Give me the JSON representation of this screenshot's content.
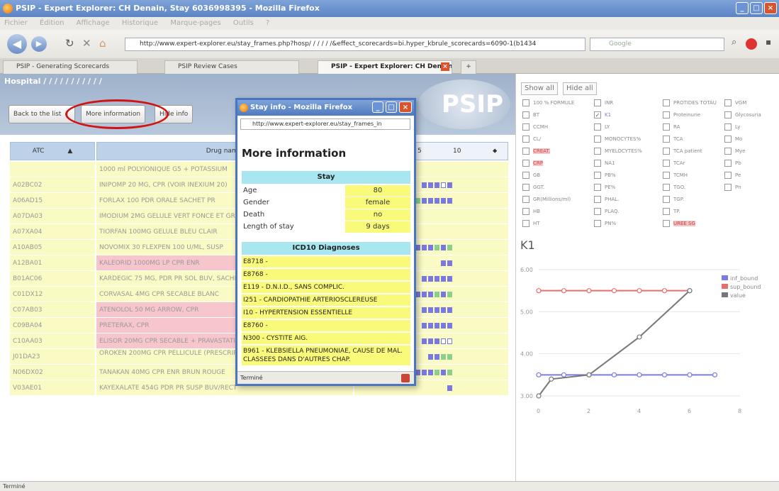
{
  "window": {
    "title": "PSIP - Expert Explorer: CH Denain, Stay 6036998395 - Mozilla Firefox"
  },
  "menu": [
    "Fichier",
    "Édition",
    "Affichage",
    "Historique",
    "Marque-pages",
    "Outils",
    "?"
  ],
  "nav": {
    "url": "http://www.expert-explorer.eu/stay_frames.php?hosp/ / / / / /&effect_scorecards=bi.hyper_kbrule_scorecards=6090-1(b1434",
    "search_placeholder": "Google"
  },
  "tabs": [
    {
      "label": "PSIP - Generating Scorecards"
    },
    {
      "label": "PSIP Review Cases"
    },
    {
      "label": "PSIP - Expert Explorer: CH Denain..."
    }
  ],
  "left": {
    "hospital_label": "Hospital",
    "hospital_name": "/ / / / / / / / / / /",
    "buttons": {
      "back": "Back to the list",
      "more": "More information",
      "hide": "Hide info"
    },
    "logo": "PSIP",
    "table": {
      "col_atc": "ATC",
      "col_drug": "Drug name",
      "col_5": "5",
      "col_10": "10",
      "rows": [
        {
          "atc": "",
          "drug": "1000 ml POLYIONIQUE G5 + POTASSIUM",
          "pink": false,
          "bar": ""
        },
        {
          "atc": "A02BC02",
          "drug": "INIPOMP 20 MG, CPR (VOIR INEXIUM 20)",
          "pink": false,
          "bar": "bbbeb"
        },
        {
          "atc": "A06AD15",
          "drug": "FORLAX 100 PDR ORALE SACHET PR",
          "pink": false,
          "bar": "gbbbbb"
        },
        {
          "atc": "A07DA03",
          "drug": "IMODIUM 2MG GELULE VERT FONCE ET GRIS",
          "pink": false,
          "bar": ""
        },
        {
          "atc": "A07XA04",
          "drug": "TIORFAN 100MG GELULE BLEU CLAIR",
          "pink": false,
          "bar": ""
        },
        {
          "atc": "A10AB05",
          "drug": "NOVOMIX 30 FLEXPEN 100 U/ML, SUSP",
          "pink": false,
          "bar": "bbbgbg"
        },
        {
          "atc": "A12BA01",
          "drug": "KALEORID 1000MG LP CPR ENR",
          "pink": true,
          "bar": "bb"
        },
        {
          "atc": "B01AC06",
          "drug": "KARDEGIC 75 MG, PDR PR SOL BUV, SACHET",
          "pink": false,
          "bar": "bbbbb"
        },
        {
          "atc": "C01DX12",
          "drug": "CORVASAL 4MG CPR SECABLE BLANC",
          "pink": false,
          "bar": "bbbgbg"
        },
        {
          "atc": "C07AB03",
          "drug": "ATENOLOL 50 MG ARROW, CPR",
          "pink": true,
          "bar": "bbbbb"
        },
        {
          "atc": "C09BA04",
          "drug": "PRETERAX, CPR",
          "pink": true,
          "bar": "bbbbb"
        },
        {
          "atc": "C10AA03",
          "drug": "ELISOR 20MG CPR SECABLE + PRAVASTATINE",
          "pink": true,
          "bar": "bbbee"
        },
        {
          "atc": "J01DA23",
          "drug": "OROKEN 200MG CPR PELLICULE (PRESCRIPTION OBLIGATOIRE ANTIBIO)",
          "pink": false,
          "bar": "bbgg"
        },
        {
          "atc": "N06DX02",
          "drug": "TANAKAN 40MG CPR ENR BRUN ROUGE",
          "pink": false,
          "bar": "gbbbbbgbg"
        },
        {
          "atc": "V03AE01",
          "drug": "KAYEXALATE 454G PDR PR SUSP BUV/RECT",
          "pink": false,
          "bar": "b"
        }
      ]
    }
  },
  "popup": {
    "title": "Stay info - Mozilla Firefox",
    "url": "http://www.expert-explorer.eu/stay_frames_in",
    "heading": "More information",
    "stay_header": "Stay",
    "stay": [
      {
        "label": "Age",
        "value": "80"
      },
      {
        "label": "Gender",
        "value": "female"
      },
      {
        "label": "Death",
        "value": "no"
      },
      {
        "label": "Length of stay",
        "value": "9 days"
      }
    ],
    "diag_header": "ICD10 Diagnoses",
    "diagnoses": [
      "E8718 -",
      "E8768 -",
      "E119 -  D.N.I.D., SANS COMPLIC.",
      "I251 -  CARDIOPATHIE ARTERIOSCLEREUSE",
      "I10 -  HYPERTENSION ESSENTIELLE",
      "E8760 -",
      "N300 -  CYSTITE AIG.",
      "B961 -  KLEBSIELLA PNEUMONIAE, CAUSE DE MAL. CLASSEES DANS D'AUTRES CHAP."
    ],
    "status": "Terminé"
  },
  "right": {
    "show_all": "Show all",
    "hide_all": "Hide all",
    "checkboxes": [
      [
        {
          "label": "100 % FORMULE",
          "checked": false,
          "red": false
        },
        {
          "label": "BT",
          "checked": false,
          "red": false
        },
        {
          "label": "CCMH",
          "checked": false,
          "red": false
        },
        {
          "label": "CL/",
          "checked": false,
          "red": false
        },
        {
          "label": "CREAT.",
          "checked": false,
          "red": true
        },
        {
          "label": "CRP",
          "checked": false,
          "red": true
        },
        {
          "label": "GB",
          "checked": false,
          "red": false
        },
        {
          "label": "GGT.",
          "checked": false,
          "red": false
        },
        {
          "label": "GR(Millions/ml)",
          "checked": false,
          "red": false
        },
        {
          "label": "HB",
          "checked": false,
          "red": false
        },
        {
          "label": "HT",
          "checked": false,
          "red": false
        }
      ],
      [
        {
          "label": "INR",
          "checked": false,
          "red": false
        },
        {
          "label": "K1",
          "checked": true,
          "red": false
        },
        {
          "label": "LY",
          "checked": false,
          "red": false
        },
        {
          "label": "MONOCYTES%",
          "checked": false,
          "red": false
        },
        {
          "label": "MYELOCYTES%",
          "checked": false,
          "red": false
        },
        {
          "label": "NA1",
          "checked": false,
          "red": false
        },
        {
          "label": "PB%",
          "checked": false,
          "red": false
        },
        {
          "label": "PE%",
          "checked": false,
          "red": false
        },
        {
          "label": "PHAL.",
          "checked": false,
          "red": false
        },
        {
          "label": "PLAQ.",
          "checked": false,
          "red": false
        },
        {
          "label": "PN%",
          "checked": false,
          "red": false
        }
      ],
      [
        {
          "label": "PROTIDES TOTAU",
          "checked": false,
          "red": false
        },
        {
          "label": "Proteinurie",
          "checked": false,
          "red": false
        },
        {
          "label": "RA",
          "checked": false,
          "red": false
        },
        {
          "label": "TCA",
          "checked": false,
          "red": false
        },
        {
          "label": "TCA patient",
          "checked": false,
          "red": false
        },
        {
          "label": "TCAr",
          "checked": false,
          "red": false
        },
        {
          "label": "TCMH",
          "checked": false,
          "red": false
        },
        {
          "label": "TGO.",
          "checked": false,
          "red": false
        },
        {
          "label": "TGP.",
          "checked": false,
          "red": false
        },
        {
          "label": "TP.",
          "checked": false,
          "red": false
        },
        {
          "label": "UREE SG",
          "checked": false,
          "red": true
        }
      ],
      [
        {
          "label": "VGM",
          "checked": false,
          "red": false
        },
        {
          "label": "Glycosuria",
          "checked": false,
          "red": false
        },
        {
          "label": "Ly",
          "checked": false,
          "red": false
        },
        {
          "label": "Mo",
          "checked": false,
          "red": false
        },
        {
          "label": "Mye",
          "checked": false,
          "red": false
        },
        {
          "label": "Pb",
          "checked": false,
          "red": false
        },
        {
          "label": "Pe",
          "checked": false,
          "red": false
        },
        {
          "label": "Pn",
          "checked": false,
          "red": false
        }
      ]
    ],
    "chart_title": "K1"
  },
  "chart_data": {
    "type": "line",
    "title": "K1",
    "xlim": [
      0,
      8
    ],
    "ylim": [
      3.0,
      6.0
    ],
    "xticks": [
      0,
      2,
      4,
      6,
      8
    ],
    "yticks": [
      3.0,
      4.0,
      5.0,
      6.0
    ],
    "ytick_labels": [
      "3.00",
      "4.00",
      "5.00",
      "6.00"
    ],
    "legend_position": "top-right",
    "grid": true,
    "series": [
      {
        "name": "inf_bound",
        "color": "#7b7be8",
        "x": [
          0,
          1,
          2,
          3,
          4,
          5,
          6,
          7
        ],
        "y": [
          3.5,
          3.5,
          3.5,
          3.5,
          3.5,
          3.5,
          3.5,
          3.5
        ]
      },
      {
        "name": "sup_bound",
        "color": "#e86e6e",
        "x": [
          0,
          1,
          2,
          3,
          4,
          5,
          6
        ],
        "y": [
          5.5,
          5.5,
          5.5,
          5.5,
          5.5,
          5.5,
          5.5
        ]
      },
      {
        "name": "value",
        "color": "#777777",
        "x": [
          0,
          0.5,
          2,
          4,
          6
        ],
        "y": [
          3.0,
          3.4,
          3.5,
          4.4,
          5.5
        ]
      }
    ]
  },
  "status": "Terminé"
}
